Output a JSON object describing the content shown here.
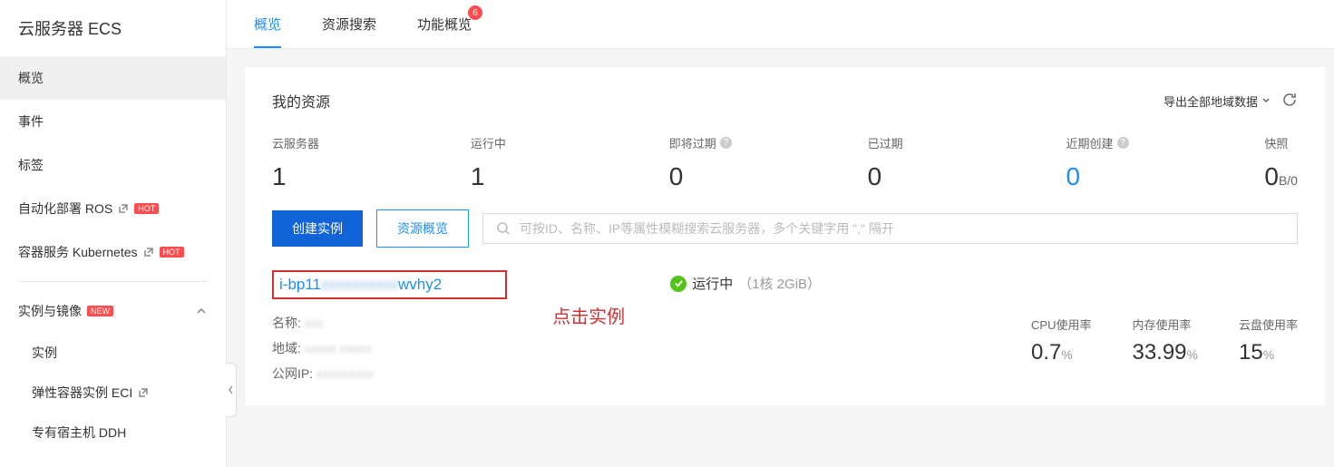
{
  "sidebar": {
    "title": "云服务器 ECS",
    "items": [
      {
        "label": "概览",
        "active": true
      },
      {
        "label": "事件"
      },
      {
        "label": "标签"
      },
      {
        "label": "自动化部署 ROS",
        "external": true,
        "badge": "HOT"
      },
      {
        "label": "容器服务 Kubernetes",
        "external": true,
        "badge": "HOT"
      }
    ],
    "group": {
      "label": "实例与镜像",
      "badge": "NEW"
    },
    "subitems": [
      {
        "label": "实例"
      },
      {
        "label": "弹性容器实例 ECI",
        "external": true
      },
      {
        "label": "专有宿主机 DDH"
      }
    ]
  },
  "tabs": [
    {
      "label": "概览",
      "active": true
    },
    {
      "label": "资源搜索"
    },
    {
      "label": "功能概览",
      "badge": "6"
    }
  ],
  "card": {
    "title": "我的资源",
    "export_label": "导出全部地域数据"
  },
  "stats": [
    {
      "label": "云服务器",
      "value": "1"
    },
    {
      "label": "运行中",
      "value": "1"
    },
    {
      "label": "即将过期",
      "value": "0",
      "help": true
    },
    {
      "label": "已过期",
      "value": "0"
    },
    {
      "label": "近期创建",
      "value": "0",
      "help": true,
      "link": true
    },
    {
      "label": "快照",
      "value": "0",
      "unit": "B/0"
    }
  ],
  "actions": {
    "create": "创建实例",
    "overview": "资源概览",
    "search_placeholder": "可按ID、名称、IP等属性模糊搜索云服务器，多个关键字用 \",\" 隔开"
  },
  "instance": {
    "id_prefix": "i-bp11",
    "id_suffix": "wvhy2",
    "name_label": "名称:",
    "region_label": "地域:",
    "ip_label": "公网IP:",
    "status": "运行中",
    "spec": "（1核 2GiB）",
    "annotation": "点击实例"
  },
  "metrics": [
    {
      "label": "CPU使用率",
      "value": "0.7",
      "unit": "%"
    },
    {
      "label": "内存使用率",
      "value": "33.99",
      "unit": "%"
    },
    {
      "label": "云盘使用率",
      "value": "15",
      "unit": "%"
    }
  ]
}
